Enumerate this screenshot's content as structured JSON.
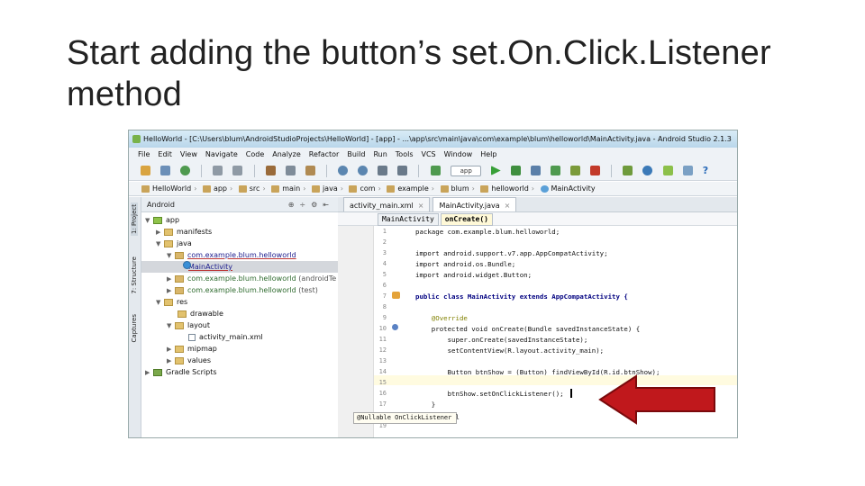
{
  "slide": {
    "title_line1": "Start adding the button’s set.On.Click.Listener",
    "title_line2": "method"
  },
  "window": {
    "title": "HelloWorld - [C:\\Users\\blum\\AndroidStudioProjects\\HelloWorld] - [app] - ...\\app\\src\\main\\java\\com\\example\\blum\\helloworld\\MainActivity.java - Android Studio 2.1.3"
  },
  "menu": [
    "File",
    "Edit",
    "View",
    "Navigate",
    "Code",
    "Analyze",
    "Refactor",
    "Build",
    "Run",
    "Tools",
    "VCS",
    "Window",
    "Help"
  ],
  "toolbar": {
    "run_config": "app",
    "help_glyph": "?"
  },
  "navbar": {
    "crumbs": [
      "HelloWorld",
      "app",
      "src",
      "main",
      "java",
      "com",
      "example",
      "blum",
      "helloworld",
      "MainActivity"
    ]
  },
  "sidestrip": {
    "tabs": [
      "1: Project",
      "7: Structure",
      "Captures"
    ]
  },
  "project_panel": {
    "view_label": "Android",
    "tree": [
      {
        "label": "app",
        "depth": 0,
        "icon": "app-folder"
      },
      {
        "label": "manifests",
        "depth": 1,
        "icon": "folder"
      },
      {
        "label": "java",
        "depth": 1,
        "icon": "folder"
      },
      {
        "label": "com.example.blum.helloworld",
        "depth": 2,
        "icon": "package"
      },
      {
        "label": "MainActivity",
        "depth": 3,
        "icon": "class",
        "selected": true
      },
      {
        "label": "com.example.blum.helloworld",
        "suffix": " (androidTe",
        "depth": 2,
        "icon": "package"
      },
      {
        "label": "com.example.blum.helloworld",
        "suffix": " (test)",
        "depth": 2,
        "icon": "package"
      },
      {
        "label": "res",
        "depth": 1,
        "icon": "folder"
      },
      {
        "label": "drawable",
        "depth": 2,
        "icon": "folder"
      },
      {
        "label": "layout",
        "depth": 2,
        "icon": "folder"
      },
      {
        "label": "activity_main.xml",
        "depth": 3,
        "icon": "file"
      },
      {
        "label": "mipmap",
        "depth": 2,
        "icon": "folder"
      },
      {
        "label": "values",
        "depth": 2,
        "icon": "folder"
      },
      {
        "label": "Gradle Scripts",
        "depth": 0,
        "icon": "gradle"
      }
    ]
  },
  "editor": {
    "tabs": [
      "activity_main.xml",
      "MainActivity.java"
    ],
    "breadcrumbs": [
      "MainActivity",
      "onCreate()"
    ],
    "lines": [
      {
        "n": "1",
        "text": "package com.example.blum.helloworld;"
      },
      {
        "n": "2",
        "text": ""
      },
      {
        "n": "3",
        "text": "import android.support.v7.app.AppCompatActivity;"
      },
      {
        "n": "4",
        "text": "import android.os.Bundle;"
      },
      {
        "n": "5",
        "text": "import android.widget.Button;"
      },
      {
        "n": "6",
        "text": ""
      },
      {
        "n": "7",
        "text": "public class MainActivity extends AppCompatActivity {"
      },
      {
        "n": "8",
        "text": ""
      },
      {
        "n": "9",
        "text": "    @Override"
      },
      {
        "n": "10",
        "text": "    protected void onCreate(Bundle savedInstanceState) {"
      },
      {
        "n": "11",
        "text": "        super.onCreate(savedInstanceState);"
      },
      {
        "n": "12",
        "text": "        setContentView(R.layout.activity_main);"
      },
      {
        "n": "13",
        "text": ""
      },
      {
        "n": "14",
        "text": "        Button btnShow = (Button) findViewById(R.id.btnShow);"
      },
      {
        "n": "15",
        "text": ""
      },
      {
        "n": "16",
        "text": "        btnShow.setOnClickListener();"
      },
      {
        "n": "17",
        "text": "    }"
      },
      {
        "n": "18",
        "text": "}"
      },
      {
        "n": "19",
        "text": ""
      }
    ],
    "hint_popup": "@Nullable OnClickListener l"
  },
  "colors": {
    "arrow": "#c0181c",
    "highlight_line": "#fffbe0"
  }
}
